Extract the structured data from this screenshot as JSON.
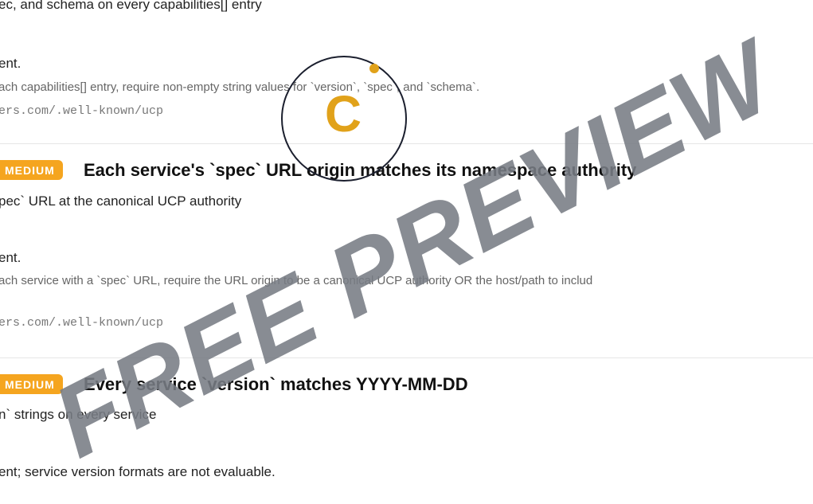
{
  "checks": [
    {
      "title_fragment": "ec, and schema on every capabilities[] entry",
      "status_fragment": "ent.",
      "description_fragment": "ach capabilities[] entry, require non-empty string values for `version`, `spec`, and `schema`.",
      "url_fragment": "ers.com/.well-known/ucp"
    },
    {
      "badge": "MEDIUM",
      "heading": "Each service's `spec` URL origin matches its namespace authority",
      "title_fragment": "pec` URL at the canonical UCP authority",
      "status_fragment": "ent.",
      "description_fragment": "ach service with a `spec` URL, require the URL origin to be a canonical UCP authority OR the host/path to includ",
      "url_fragment": "ers.com/.well-known/ucp"
    },
    {
      "badge": "MEDIUM",
      "heading": "Every service `version` matches YYYY-MM-DD",
      "title_fragment": "n` strings on every service",
      "status_fragment": "ent; service version formats are not evaluable."
    }
  ],
  "logo": {
    "letter": "C",
    "accent_color": "#e1a21a",
    "ring_color": "#1b1f2e"
  },
  "watermark": {
    "text": "FREE PREVIEW"
  }
}
